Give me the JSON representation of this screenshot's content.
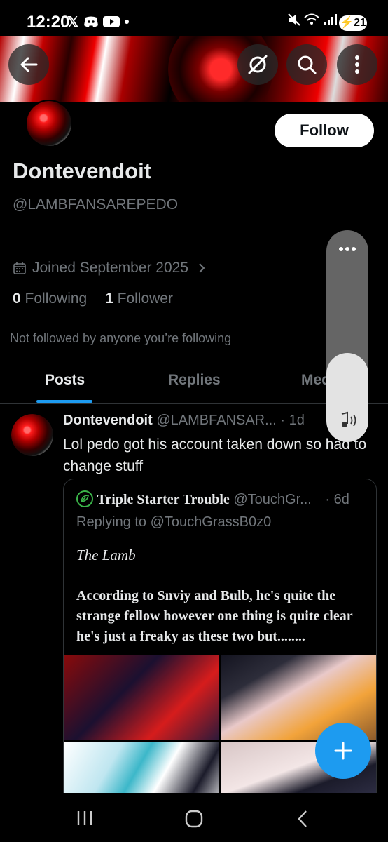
{
  "status_bar": {
    "time": "12:20",
    "left_icons": [
      "x-logo-icon",
      "discord-icon",
      "youtube-icon",
      "dot-icon"
    ],
    "right_icons": [
      "mute-icon",
      "wifi-icon",
      "signal-icon"
    ],
    "battery": "21"
  },
  "toolbar": {
    "back_icon": "arrow-left-icon",
    "grok_icon": "grok-icon",
    "search_icon": "search-icon",
    "more_icon": "more-vertical-icon"
  },
  "profile": {
    "display_name": "Dontevendoit",
    "handle": "@LAMBFANSAREPEDO",
    "joined": "Joined September 2025",
    "following_count": "0",
    "following_label": "Following",
    "followers_count": "1",
    "followers_label": "Follower",
    "not_followed": "Not followed by anyone you’re following",
    "follow_button": "Follow"
  },
  "tabs": [
    "Posts",
    "Replies",
    "Media"
  ],
  "active_tab": "Posts",
  "volume": {
    "level": 0.42,
    "more_icon": "more-horizontal-icon",
    "mode_icon": "music-note-icon"
  },
  "post": {
    "author": "Dontevendoit",
    "handle": "@LAMBFANSAR...",
    "age": "· 1d",
    "text": "Lol pedo got his account taken down so had to change stuff",
    "quote": {
      "author": "Triple Starter Trouble",
      "handle": "@TouchGr...",
      "age": "· 6d",
      "replying": "Replying to @TouchGrassB0z0",
      "title": "The Lamb",
      "body": "According to Snviy and Bulb, he's quite the strange fellow however one thing is quite clear he's just a freaky as these two but........"
    }
  },
  "fab_icon": "plus-icon",
  "nav": [
    "recents-icon",
    "home-icon",
    "back-icon"
  ],
  "colors": {
    "accent": "#1d9bf0",
    "background": "#000000",
    "secondary_text": "#71767b"
  }
}
